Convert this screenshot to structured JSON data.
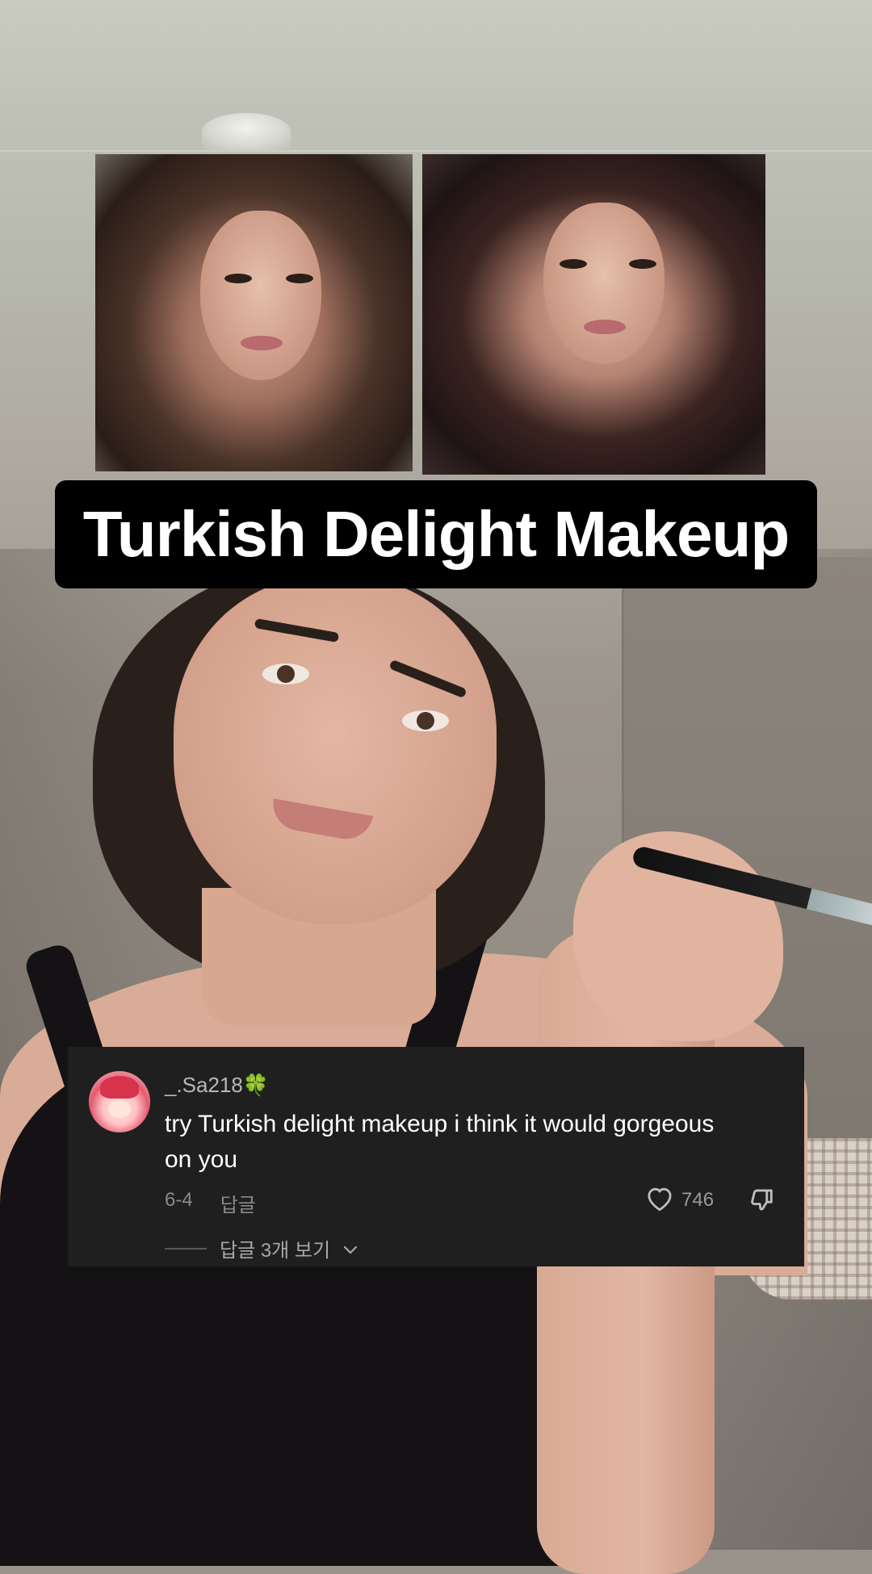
{
  "title_banner": {
    "text": "Turkish Delight Makeup"
  },
  "comment": {
    "username": "_.Sa218",
    "username_emoji": "🍀",
    "text": "try Turkish delight makeup i think it would gorgeous on you",
    "date": "6-4",
    "reply_label": "답글",
    "like_count": "746",
    "view_replies_label": "답글 3개 보기",
    "icons": {
      "like": "heart-outline-icon",
      "dislike": "thumbs-down-outline-icon",
      "expand": "chevron-down-icon"
    },
    "colors": {
      "card_bg": "#1f1f1f",
      "muted_text": "#8a8a8a"
    }
  }
}
